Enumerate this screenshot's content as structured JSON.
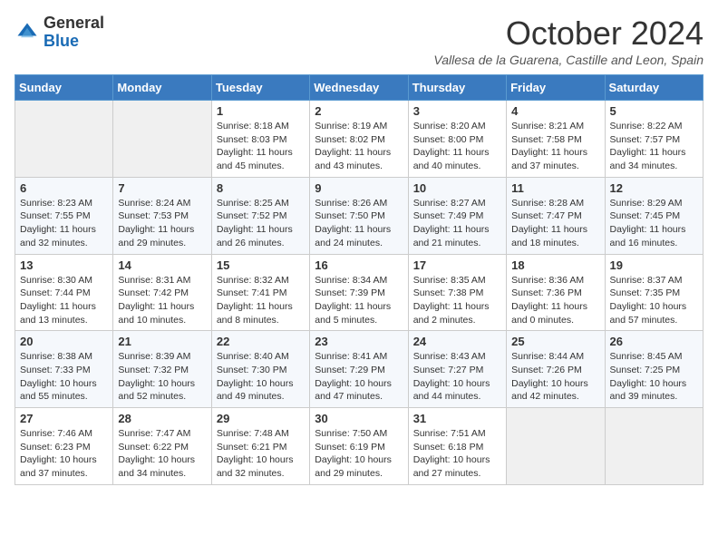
{
  "header": {
    "logo_general": "General",
    "logo_blue": "Blue",
    "month_title": "October 2024",
    "location": "Vallesa de la Guarena, Castille and Leon, Spain"
  },
  "weekdays": [
    "Sunday",
    "Monday",
    "Tuesday",
    "Wednesday",
    "Thursday",
    "Friday",
    "Saturday"
  ],
  "weeks": [
    [
      {
        "day": "",
        "info": ""
      },
      {
        "day": "",
        "info": ""
      },
      {
        "day": "1",
        "info": "Sunrise: 8:18 AM\nSunset: 8:03 PM\nDaylight: 11 hours and 45 minutes."
      },
      {
        "day": "2",
        "info": "Sunrise: 8:19 AM\nSunset: 8:02 PM\nDaylight: 11 hours and 43 minutes."
      },
      {
        "day": "3",
        "info": "Sunrise: 8:20 AM\nSunset: 8:00 PM\nDaylight: 11 hours and 40 minutes."
      },
      {
        "day": "4",
        "info": "Sunrise: 8:21 AM\nSunset: 7:58 PM\nDaylight: 11 hours and 37 minutes."
      },
      {
        "day": "5",
        "info": "Sunrise: 8:22 AM\nSunset: 7:57 PM\nDaylight: 11 hours and 34 minutes."
      }
    ],
    [
      {
        "day": "6",
        "info": "Sunrise: 8:23 AM\nSunset: 7:55 PM\nDaylight: 11 hours and 32 minutes."
      },
      {
        "day": "7",
        "info": "Sunrise: 8:24 AM\nSunset: 7:53 PM\nDaylight: 11 hours and 29 minutes."
      },
      {
        "day": "8",
        "info": "Sunrise: 8:25 AM\nSunset: 7:52 PM\nDaylight: 11 hours and 26 minutes."
      },
      {
        "day": "9",
        "info": "Sunrise: 8:26 AM\nSunset: 7:50 PM\nDaylight: 11 hours and 24 minutes."
      },
      {
        "day": "10",
        "info": "Sunrise: 8:27 AM\nSunset: 7:49 PM\nDaylight: 11 hours and 21 minutes."
      },
      {
        "day": "11",
        "info": "Sunrise: 8:28 AM\nSunset: 7:47 PM\nDaylight: 11 hours and 18 minutes."
      },
      {
        "day": "12",
        "info": "Sunrise: 8:29 AM\nSunset: 7:45 PM\nDaylight: 11 hours and 16 minutes."
      }
    ],
    [
      {
        "day": "13",
        "info": "Sunrise: 8:30 AM\nSunset: 7:44 PM\nDaylight: 11 hours and 13 minutes."
      },
      {
        "day": "14",
        "info": "Sunrise: 8:31 AM\nSunset: 7:42 PM\nDaylight: 11 hours and 10 minutes."
      },
      {
        "day": "15",
        "info": "Sunrise: 8:32 AM\nSunset: 7:41 PM\nDaylight: 11 hours and 8 minutes."
      },
      {
        "day": "16",
        "info": "Sunrise: 8:34 AM\nSunset: 7:39 PM\nDaylight: 11 hours and 5 minutes."
      },
      {
        "day": "17",
        "info": "Sunrise: 8:35 AM\nSunset: 7:38 PM\nDaylight: 11 hours and 2 minutes."
      },
      {
        "day": "18",
        "info": "Sunrise: 8:36 AM\nSunset: 7:36 PM\nDaylight: 11 hours and 0 minutes."
      },
      {
        "day": "19",
        "info": "Sunrise: 8:37 AM\nSunset: 7:35 PM\nDaylight: 10 hours and 57 minutes."
      }
    ],
    [
      {
        "day": "20",
        "info": "Sunrise: 8:38 AM\nSunset: 7:33 PM\nDaylight: 10 hours and 55 minutes."
      },
      {
        "day": "21",
        "info": "Sunrise: 8:39 AM\nSunset: 7:32 PM\nDaylight: 10 hours and 52 minutes."
      },
      {
        "day": "22",
        "info": "Sunrise: 8:40 AM\nSunset: 7:30 PM\nDaylight: 10 hours and 49 minutes."
      },
      {
        "day": "23",
        "info": "Sunrise: 8:41 AM\nSunset: 7:29 PM\nDaylight: 10 hours and 47 minutes."
      },
      {
        "day": "24",
        "info": "Sunrise: 8:43 AM\nSunset: 7:27 PM\nDaylight: 10 hours and 44 minutes."
      },
      {
        "day": "25",
        "info": "Sunrise: 8:44 AM\nSunset: 7:26 PM\nDaylight: 10 hours and 42 minutes."
      },
      {
        "day": "26",
        "info": "Sunrise: 8:45 AM\nSunset: 7:25 PM\nDaylight: 10 hours and 39 minutes."
      }
    ],
    [
      {
        "day": "27",
        "info": "Sunrise: 7:46 AM\nSunset: 6:23 PM\nDaylight: 10 hours and 37 minutes."
      },
      {
        "day": "28",
        "info": "Sunrise: 7:47 AM\nSunset: 6:22 PM\nDaylight: 10 hours and 34 minutes."
      },
      {
        "day": "29",
        "info": "Sunrise: 7:48 AM\nSunset: 6:21 PM\nDaylight: 10 hours and 32 minutes."
      },
      {
        "day": "30",
        "info": "Sunrise: 7:50 AM\nSunset: 6:19 PM\nDaylight: 10 hours and 29 minutes."
      },
      {
        "day": "31",
        "info": "Sunrise: 7:51 AM\nSunset: 6:18 PM\nDaylight: 10 hours and 27 minutes."
      },
      {
        "day": "",
        "info": ""
      },
      {
        "day": "",
        "info": ""
      }
    ]
  ]
}
